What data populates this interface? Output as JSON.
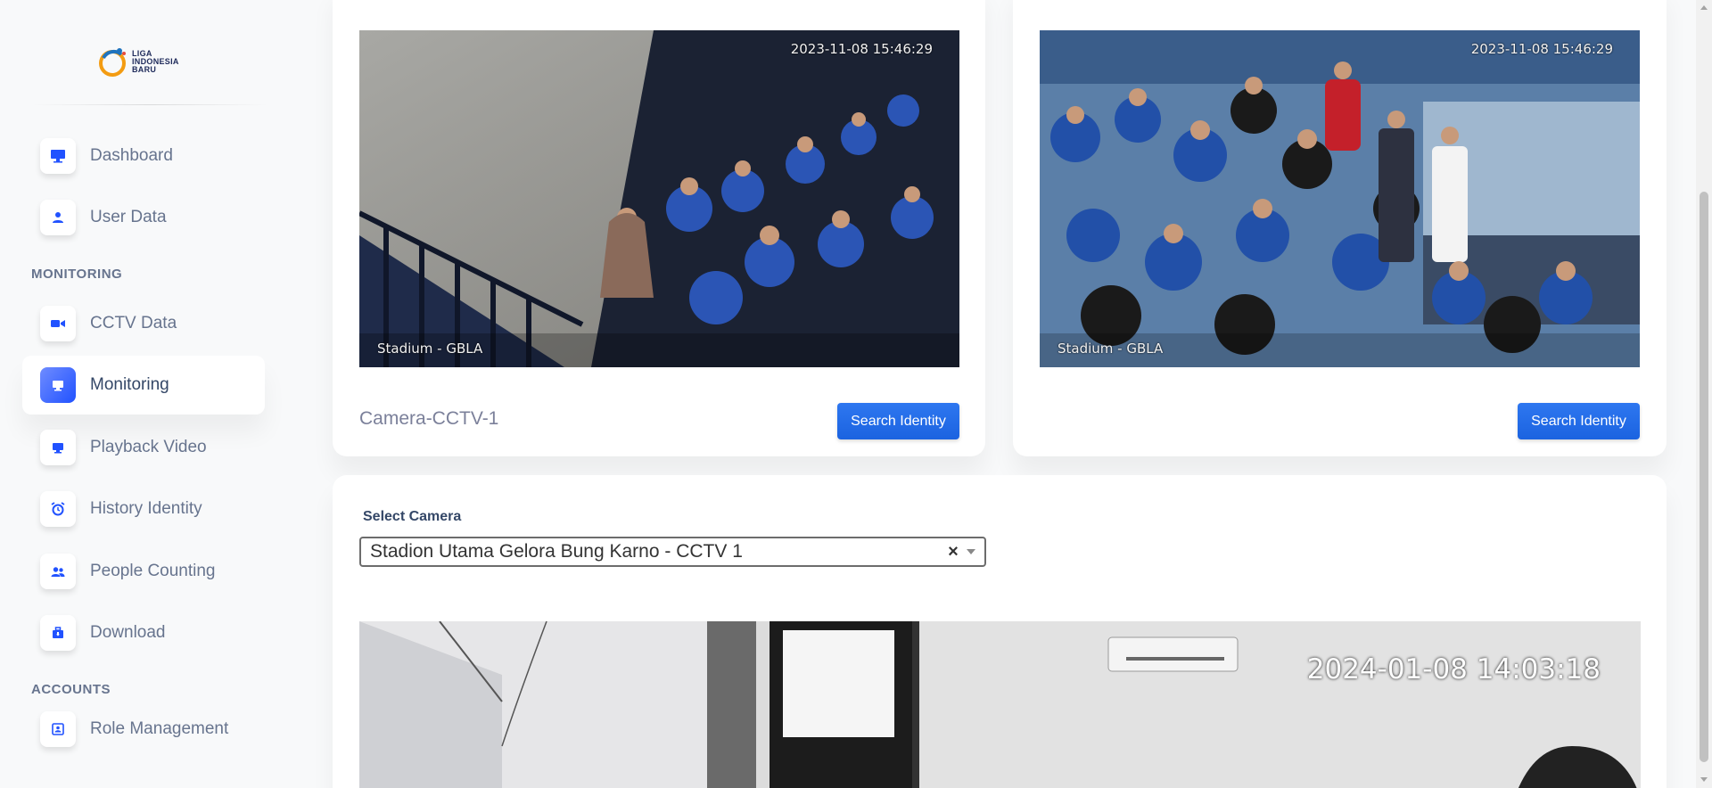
{
  "sidebar": {
    "logo_text": [
      "LIGA",
      "INDONESIA",
      "BARU"
    ],
    "items": [
      {
        "label": "Dashboard",
        "icon": "monitor-icon"
      },
      {
        "label": "User Data",
        "icon": "user-icon"
      },
      {
        "label": "CCTV Data",
        "icon": "video-camera-icon"
      },
      {
        "label": "Monitoring",
        "icon": "display-icon",
        "active": true
      },
      {
        "label": "Playback Video",
        "icon": "display-icon"
      },
      {
        "label": "History Identity",
        "icon": "alarm-clock-icon"
      },
      {
        "label": "People Counting",
        "icon": "users-icon"
      },
      {
        "label": "Download",
        "icon": "briefcase-download-icon"
      },
      {
        "label": "Role Management",
        "icon": "id-card-icon"
      }
    ],
    "sections": {
      "monitoring": "MONITORING",
      "accounts": "ACCOUNTS"
    }
  },
  "cameras": [
    {
      "timestamp": "2023-11-08 15:46:29",
      "location": "Stadium - GBLA",
      "title": "Camera-CCTV-1",
      "button": "Search Identity"
    },
    {
      "timestamp": "2023-11-08 15:46:29",
      "location": "Stadium - GBLA",
      "title": "",
      "button": "Search Identity"
    }
  ],
  "select_camera": {
    "label": "Select Camera",
    "value": "Stadion Utama Gelora Bung Karno - CCTV 1",
    "clear": "×"
  },
  "live_feed": {
    "timestamp": "2024-01-08 14:03:18"
  },
  "colors": {
    "accent": "#2152ff",
    "button": "#1f6feb",
    "muted_text": "#67748e"
  }
}
